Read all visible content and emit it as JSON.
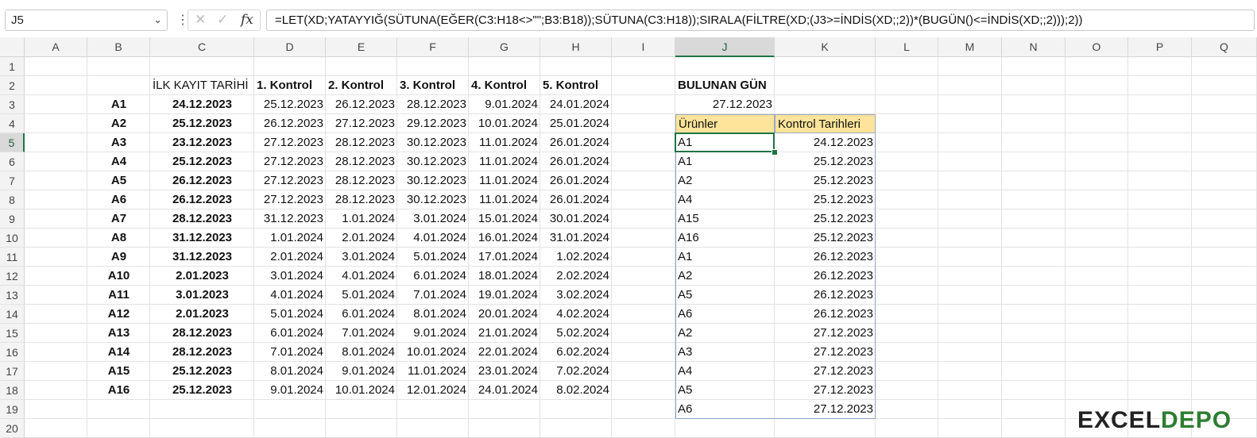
{
  "formula_bar": {
    "name_box": "J5",
    "formula": "=LET(XD;YATAYYIĞ(SÜTUNA(EĞER(C3:H18<>\"\";B3:B18));SÜTUNA(C3:H18));SIRALA(FİLTRE(XD;(J3>=İNDİS(XD;;2))*(BUGÜN()<=İNDİS(XD;;2)));2))",
    "fx_label": "fx"
  },
  "columns": [
    "A",
    "B",
    "C",
    "D",
    "E",
    "F",
    "G",
    "H",
    "I",
    "J",
    "K",
    "L",
    "M",
    "N",
    "O",
    "P",
    "Q"
  ],
  "rows": [
    "1",
    "2",
    "3",
    "4",
    "5",
    "6",
    "7",
    "8",
    "9",
    "10",
    "11",
    "12",
    "13",
    "14",
    "15",
    "16",
    "17",
    "18",
    "19",
    "20"
  ],
  "headers": [
    "İLK KAYIT TARİHİ",
    "1. Kontrol",
    "2. Kontrol",
    "3. Kontrol",
    "4. Kontrol",
    "5. Kontrol"
  ],
  "table": [
    {
      "id": "A1",
      "first": "24.12.2023",
      "checks": [
        "25.12.2023",
        "26.12.2023",
        "28.12.2023",
        "9.01.2024",
        "24.01.2024"
      ]
    },
    {
      "id": "A2",
      "first": "25.12.2023",
      "checks": [
        "26.12.2023",
        "27.12.2023",
        "29.12.2023",
        "10.01.2024",
        "25.01.2024"
      ]
    },
    {
      "id": "A3",
      "first": "23.12.2023",
      "checks": [
        "27.12.2023",
        "28.12.2023",
        "30.12.2023",
        "11.01.2024",
        "26.01.2024"
      ]
    },
    {
      "id": "A4",
      "first": "25.12.2023",
      "checks": [
        "27.12.2023",
        "28.12.2023",
        "30.12.2023",
        "11.01.2024",
        "26.01.2024"
      ]
    },
    {
      "id": "A5",
      "first": "26.12.2023",
      "checks": [
        "27.12.2023",
        "28.12.2023",
        "30.12.2023",
        "11.01.2024",
        "26.01.2024"
      ]
    },
    {
      "id": "A6",
      "first": "26.12.2023",
      "checks": [
        "27.12.2023",
        "28.12.2023",
        "30.12.2023",
        "11.01.2024",
        "26.01.2024"
      ]
    },
    {
      "id": "A7",
      "first": "28.12.2023",
      "checks": [
        "31.12.2023",
        "1.01.2024",
        "3.01.2024",
        "15.01.2024",
        "30.01.2024"
      ]
    },
    {
      "id": "A8",
      "first": "31.12.2023",
      "checks": [
        "1.01.2024",
        "2.01.2024",
        "4.01.2024",
        "16.01.2024",
        "31.01.2024"
      ]
    },
    {
      "id": "A9",
      "first": "31.12.2023",
      "checks": [
        "2.01.2024",
        "3.01.2024",
        "5.01.2024",
        "17.01.2024",
        "1.02.2024"
      ]
    },
    {
      "id": "A10",
      "first": "2.01.2023",
      "checks": [
        "3.01.2024",
        "4.01.2024",
        "6.01.2024",
        "18.01.2024",
        "2.02.2024"
      ]
    },
    {
      "id": "A11",
      "first": "3.01.2023",
      "checks": [
        "4.01.2024",
        "5.01.2024",
        "7.01.2024",
        "19.01.2024",
        "3.02.2024"
      ]
    },
    {
      "id": "A12",
      "first": "2.01.2023",
      "checks": [
        "5.01.2024",
        "6.01.2024",
        "8.01.2024",
        "20.01.2024",
        "4.02.2024"
      ]
    },
    {
      "id": "A13",
      "first": "28.12.2023",
      "checks": [
        "6.01.2024",
        "7.01.2024",
        "9.01.2024",
        "21.01.2024",
        "5.02.2024"
      ]
    },
    {
      "id": "A14",
      "first": "28.12.2023",
      "checks": [
        "7.01.2024",
        "8.01.2024",
        "10.01.2024",
        "22.01.2024",
        "6.02.2024"
      ]
    },
    {
      "id": "A15",
      "first": "25.12.2023",
      "checks": [
        "8.01.2024",
        "9.01.2024",
        "11.01.2024",
        "23.01.2024",
        "7.02.2024"
      ]
    },
    {
      "id": "A16",
      "first": "25.12.2023",
      "checks": [
        "9.01.2024",
        "10.01.2024",
        "12.01.2024",
        "24.01.2024",
        "8.02.2024"
      ]
    }
  ],
  "lookup": {
    "label": "BULUNAN GÜN",
    "value": "27.12.2023",
    "col_products": "Ürünler",
    "col_dates": "Kontrol Tarihleri",
    "results": [
      [
        "A1",
        "24.12.2023"
      ],
      [
        "A1",
        "25.12.2023"
      ],
      [
        "A2",
        "25.12.2023"
      ],
      [
        "A4",
        "25.12.2023"
      ],
      [
        "A15",
        "25.12.2023"
      ],
      [
        "A16",
        "25.12.2023"
      ],
      [
        "A1",
        "26.12.2023"
      ],
      [
        "A2",
        "26.12.2023"
      ],
      [
        "A5",
        "26.12.2023"
      ],
      [
        "A6",
        "26.12.2023"
      ],
      [
        "A2",
        "27.12.2023"
      ],
      [
        "A3",
        "27.12.2023"
      ],
      [
        "A4",
        "27.12.2023"
      ],
      [
        "A5",
        "27.12.2023"
      ],
      [
        "A6",
        "27.12.2023"
      ]
    ]
  },
  "logo": {
    "part1": "EXCEL",
    "part2": "DEPO"
  },
  "colors": {
    "accent_green": "#217346",
    "header_fill": "#fde49a",
    "table_border": "#8aa3c8"
  }
}
